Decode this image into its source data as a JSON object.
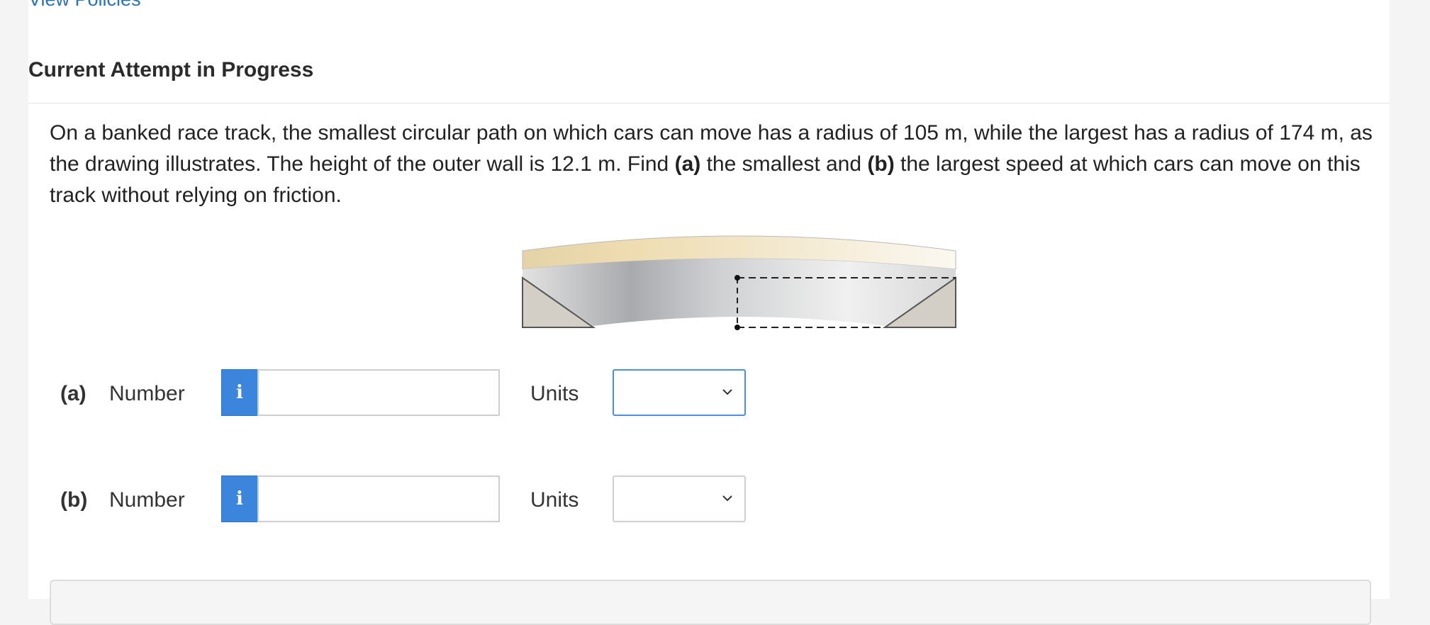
{
  "top_link": "View Policies",
  "heading": "Current Attempt in Progress",
  "question": {
    "part1": "On a banked race track, the smallest circular path on which cars can move has a radius of 105 m, while the largest has a radius of 174 m, as the drawing illustrates. The height of the outer wall is 12.1 m. Find ",
    "a_tag": "(a)",
    "part2": " the smallest and ",
    "b_tag": "(b)",
    "part3": " the largest speed at which cars can move on this track without relying on friction."
  },
  "answers": [
    {
      "label": "(a)",
      "number_label": "Number",
      "info_icon": "i",
      "value": "",
      "units_label": "Units",
      "units_value": ""
    },
    {
      "label": "(b)",
      "number_label": "Number",
      "info_icon": "i",
      "value": "",
      "units_label": "Units",
      "units_value": ""
    }
  ],
  "colors": {
    "accent": "#3b86dc",
    "link": "#2a73b8",
    "focus": "#4a90e2"
  }
}
